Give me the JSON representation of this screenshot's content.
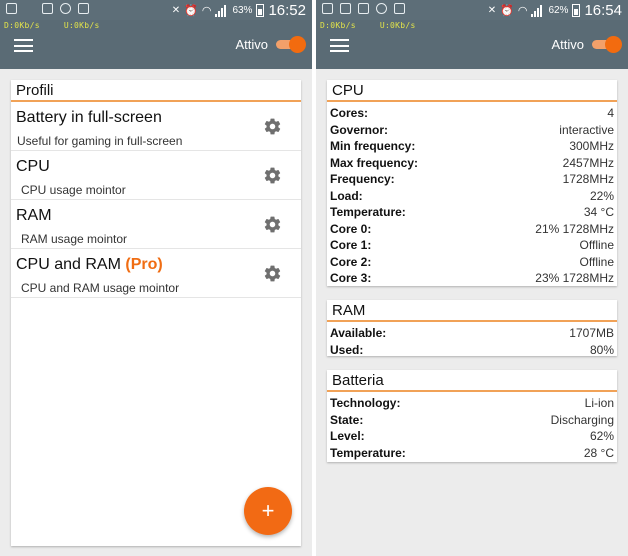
{
  "left": {
    "status": {
      "battery": "63%",
      "time": "16:52"
    },
    "traffic": {
      "down": "D:0Kb/s",
      "up": "U:0Kb/s"
    },
    "appbar": {
      "toggle_label": "Attivo"
    },
    "profiles": {
      "title": "Profili",
      "items": [
        {
          "name": "Battery in full-screen",
          "name_pro": "",
          "desc": "Useful for gaming in full-screen"
        },
        {
          "name": "CPU",
          "name_pro": "",
          "desc": "CPU usage mointor"
        },
        {
          "name": "RAM",
          "name_pro": "",
          "desc": "RAM usage mointor"
        },
        {
          "name": "CPU and RAM ",
          "name_pro": "(Pro)",
          "desc": "CPU and RAM usage mointor"
        }
      ]
    },
    "fab_label": "+"
  },
  "right": {
    "status": {
      "battery": "62%",
      "time": "16:54"
    },
    "traffic": {
      "down": "D:0Kb/s",
      "up": "U:0Kb/s"
    },
    "appbar": {
      "toggle_label": "Attivo"
    },
    "cpu": {
      "title": "CPU",
      "rows": [
        {
          "k": "Cores:",
          "v": "4"
        },
        {
          "k": "Governor:",
          "v": "interactive"
        },
        {
          "k": "Min frequency:",
          "v": "300MHz"
        },
        {
          "k": "Max frequency:",
          "v": "2457MHz"
        },
        {
          "k": "Frequency:",
          "v": "1728MHz"
        },
        {
          "k": "Load:",
          "v": "22%"
        },
        {
          "k": "Temperature:",
          "v": "34 °C"
        },
        {
          "k": "Core 0:",
          "v": "21% 1728MHz"
        },
        {
          "k": "Core 1:",
          "v": "Offline"
        },
        {
          "k": "Core 2:",
          "v": "Offline"
        },
        {
          "k": "Core 3:",
          "v": "23% 1728MHz"
        }
      ]
    },
    "ram": {
      "title": "RAM",
      "rows": [
        {
          "k": "Available:",
          "v": "1707MB"
        },
        {
          "k": "Used:",
          "v": "80%"
        }
      ]
    },
    "battery": {
      "title": "Batteria",
      "rows": [
        {
          "k": "Technology:",
          "v": "Li-ion"
        },
        {
          "k": "State:",
          "v": "Discharging"
        },
        {
          "k": "Level:",
          "v": "62%"
        },
        {
          "k": "Temperature:",
          "v": "28 °C"
        }
      ]
    }
  },
  "colors": {
    "accent": "#f26b0f",
    "appbar": "#5a6b75",
    "statusbar": "#5d6e78",
    "traffic_text": "#e2e34a"
  },
  "icons": {
    "menu": "hamburger-menu-icon",
    "settings": "gear-icon",
    "add": "plus-icon"
  }
}
